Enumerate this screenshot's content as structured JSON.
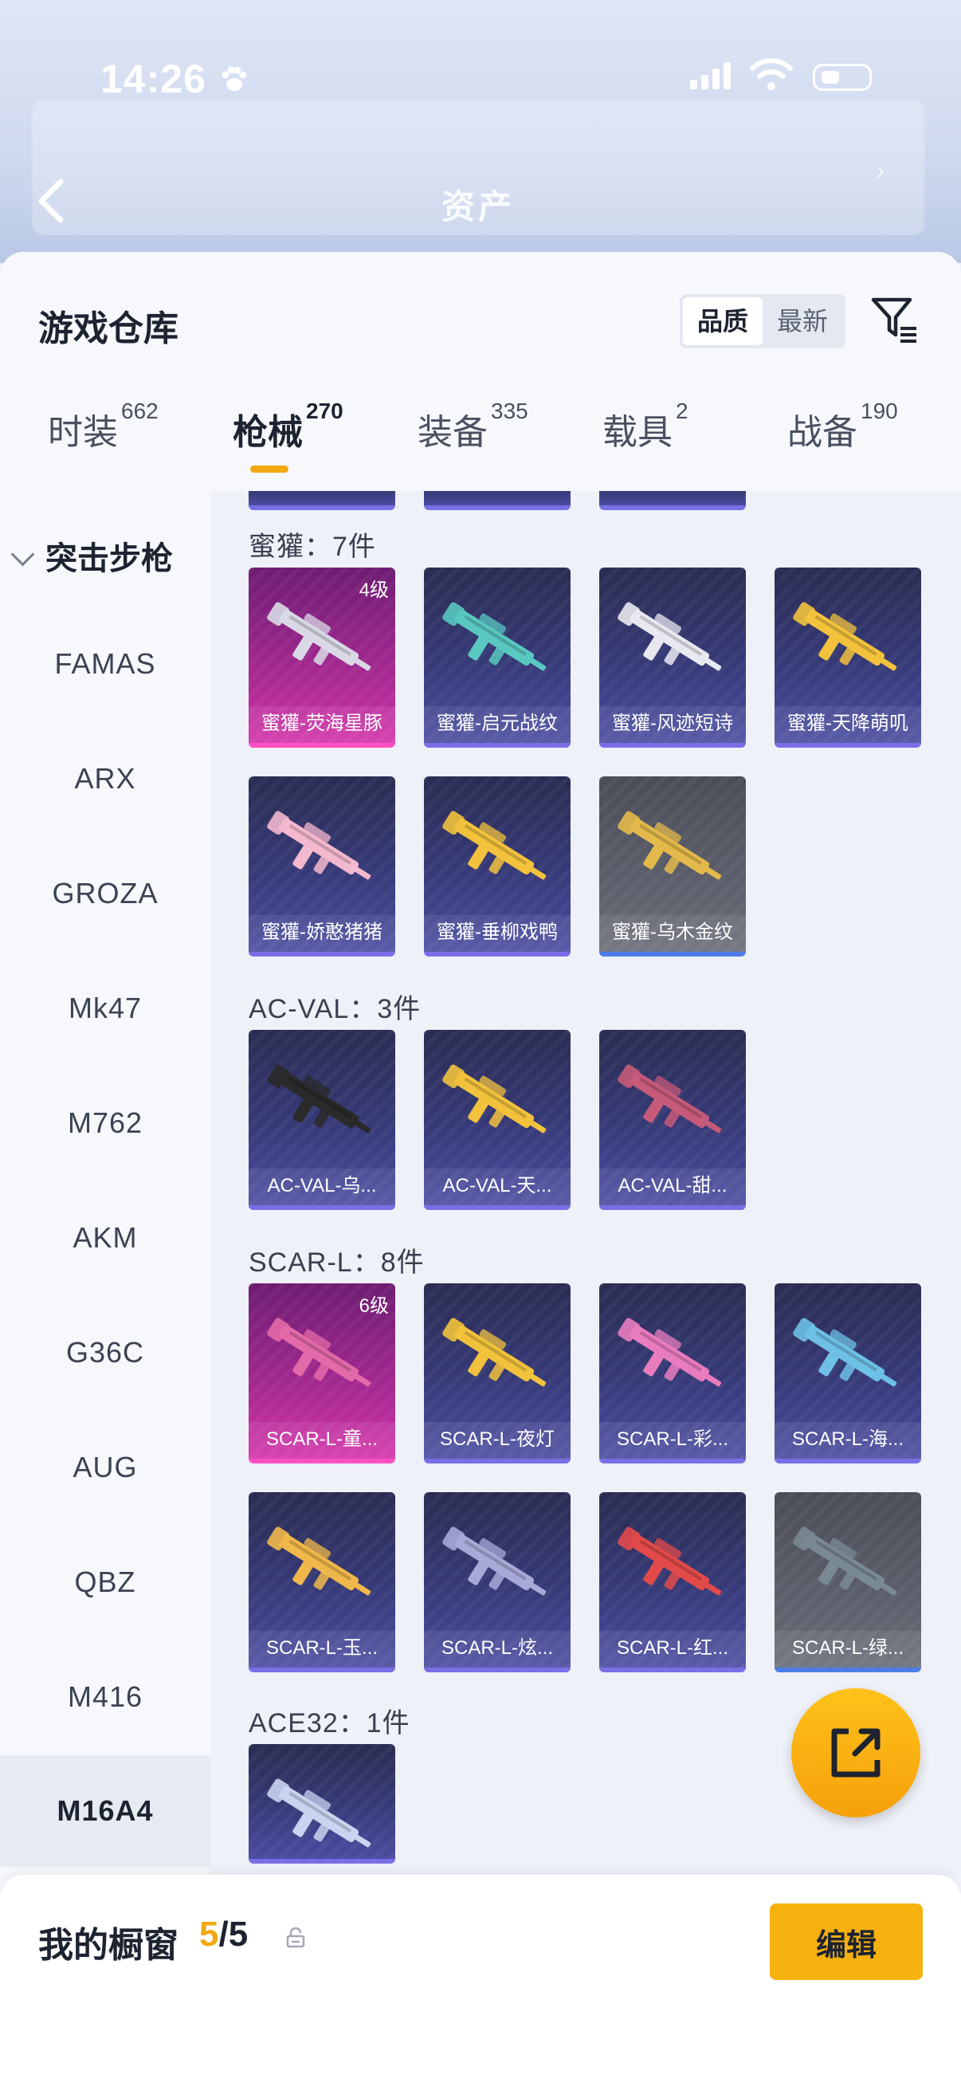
{
  "status_bar": {
    "time": "14:26"
  },
  "header": {
    "title": "资产"
  },
  "warehouse": {
    "title": "游戏仓库",
    "sort_options": [
      "品质",
      "最新"
    ],
    "tabs": [
      {
        "label": "时装",
        "count": "662"
      },
      {
        "label": "枪械",
        "count": "270"
      },
      {
        "label": "装备",
        "count": "335"
      },
      {
        "label": "载具",
        "count": "2"
      },
      {
        "label": "战备",
        "count": "190"
      }
    ]
  },
  "sidebar": {
    "category": "突击步枪",
    "items": [
      "FAMAS",
      "ARX",
      "GROZA",
      "Mk47",
      "M762",
      "AKM",
      "G36C",
      "AUG",
      "QBZ",
      "M416",
      "M16A4"
    ],
    "active_item": "M16A4"
  },
  "groups": [
    {
      "label": "蜜獾：7件",
      "items": [
        {
          "name": "蜜獾-荧海星豚",
          "level": "4级",
          "rarity": "pink"
        },
        {
          "name": "蜜獾-启元战纹",
          "rarity": "purple"
        },
        {
          "name": "蜜獾-风迹短诗",
          "rarity": "purple"
        },
        {
          "name": "蜜獾-天降萌叽",
          "rarity": "purple"
        },
        {
          "name": "蜜獾-娇憨猪猪",
          "rarity": "purple"
        },
        {
          "name": "蜜獾-垂柳戏鸭",
          "rarity": "purple"
        },
        {
          "name": "蜜獾-乌木金纹",
          "rarity": "grey"
        }
      ]
    },
    {
      "label": "AC-VAL：3件",
      "items": [
        {
          "name": "AC-VAL-乌...",
          "rarity": "purple"
        },
        {
          "name": "AC-VAL-天...",
          "rarity": "purple"
        },
        {
          "name": "AC-VAL-甜...",
          "rarity": "purple"
        }
      ]
    },
    {
      "label": "SCAR-L：8件",
      "items": [
        {
          "name": "SCAR-L-童...",
          "level": "6级",
          "rarity": "pink"
        },
        {
          "name": "SCAR-L-夜灯",
          "rarity": "purple"
        },
        {
          "name": "SCAR-L-彩...",
          "rarity": "purple"
        },
        {
          "name": "SCAR-L-海...",
          "rarity": "purple"
        },
        {
          "name": "SCAR-L-玉...",
          "rarity": "purple"
        },
        {
          "name": "SCAR-L-炫...",
          "rarity": "purple"
        },
        {
          "name": "SCAR-L-红...",
          "rarity": "purple"
        },
        {
          "name": "SCAR-L-绿...",
          "rarity": "grey"
        }
      ]
    },
    {
      "label": "ACE32：1件",
      "items": [
        {
          "name": "",
          "rarity": "purple"
        }
      ]
    }
  ],
  "showcase": {
    "label": "我的橱窗",
    "current": "5",
    "total": "/5",
    "edit_label": "编辑"
  },
  "colors": {
    "accent": "#f7b10e",
    "purple_card": "#363a78",
    "pink_card": "#a0288f",
    "grey_card": "#5c5f6b"
  }
}
